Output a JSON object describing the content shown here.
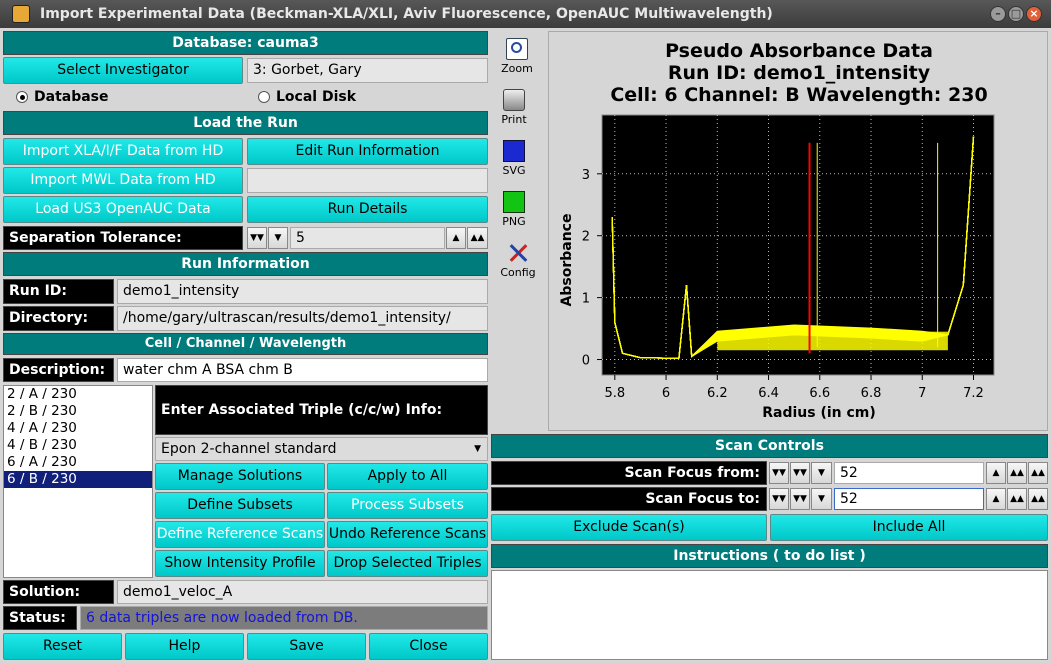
{
  "window": {
    "title": "Import Experimental Data (Beckman-XLA/XLI, Aviv Fluorescence, OpenAUC Multiwavelength)"
  },
  "left": {
    "database_header": "Database: cauma3",
    "select_investigator": "Select Investigator",
    "investigator_value": "3: Gorbet, Gary",
    "radio_database": "Database",
    "radio_local": "Local Disk",
    "load_run_header": "Load the Run",
    "import_xla": "Import XLA/I/F Data from HD",
    "edit_run_info": "Edit Run Information",
    "import_mwl": "Import MWL Data from HD",
    "load_us3": "Load US3 OpenAUC Data",
    "run_details": "Run Details",
    "sep_tol_label": "Separation Tolerance:",
    "sep_tol_value": "5",
    "run_info_header": "Run Information",
    "run_id_label": "Run ID:",
    "run_id_value": "demo1_intensity",
    "directory_label": "Directory:",
    "directory_value": "/home/gary/ultrascan/results/demo1_intensity/",
    "ccw_header": "Cell / Channel / Wavelength",
    "description_label": "Description:",
    "description_value": "water chm A BSA chm B",
    "triples": [
      "2 / A / 230",
      "2 / B / 230",
      "4 / A / 230",
      "4 / B / 230",
      "6 / A / 230",
      "6 / B / 230"
    ],
    "assoc_triple": "Enter Associated Triple (c/c/w) Info:",
    "centerpiece": "Epon 2-channel standard",
    "manage_solutions": "Manage Solutions",
    "apply_all": "Apply to All",
    "define_subsets": "Define Subsets",
    "process_subsets": "Process Subsets",
    "define_ref": "Define Reference Scans",
    "undo_ref": "Undo Reference Scans",
    "show_intensity": "Show Intensity Profile",
    "drop_triples": "Drop Selected Triples",
    "solution_label": "Solution:",
    "solution_value": "demo1_veloc_A",
    "status_label": "Status:",
    "status_value": "6 data triples are now loaded from DB.",
    "reset": "Reset",
    "help": "Help",
    "save": "Save",
    "close": "Close"
  },
  "toolbar": {
    "zoom": "Zoom",
    "print": "Print",
    "svg": "SVG",
    "png": "PNG",
    "config": "Config"
  },
  "scan": {
    "header": "Scan Controls",
    "from_label": "Scan Focus from:",
    "from_value": "52",
    "to_label": "Scan Focus to:",
    "to_value": "52",
    "exclude": "Exclude Scan(s)",
    "include_all": "Include All",
    "instructions": "Instructions ( to do list )"
  },
  "colors": {
    "teal_header": "#007c7c",
    "cyan_button": "#00d0d0",
    "plot_trace": "#ffff00",
    "highlight_scan": "#ff0000"
  },
  "chart_data": {
    "type": "line",
    "title_lines": [
      "Pseudo Absorbance Data",
      "Run ID: demo1_intensity",
      "Cell: 6  Channel: B  Wavelength: 230"
    ],
    "xlabel": "Radius (in cm)",
    "ylabel": "Absorbance",
    "xlim": [
      5.75,
      7.28
    ],
    "ylim": [
      -0.25,
      3.95
    ],
    "xticks": [
      5.8,
      6,
      6.2,
      6.4,
      6.6,
      6.8,
      7,
      7.2
    ],
    "yticks": [
      0,
      1,
      2,
      3
    ],
    "grid": true,
    "meniscus_x": 6.08,
    "vertical_spikes": [
      6.56,
      6.59,
      7.06
    ],
    "highlighted_scan_x": 6.56,
    "series": [
      {
        "values": [
          [
            5.79,
            2.3
          ],
          [
            5.8,
            0.6
          ],
          [
            5.83,
            0.1
          ],
          [
            5.9,
            0.03
          ],
          [
            6.05,
            0.02
          ],
          [
            6.08,
            1.2
          ],
          [
            6.1,
            0.05
          ],
          [
            6.2,
            0.3
          ],
          [
            6.5,
            0.4
          ],
          [
            6.8,
            0.35
          ],
          [
            7.0,
            0.3
          ],
          [
            7.1,
            0.4
          ],
          [
            7.16,
            1.2
          ],
          [
            7.2,
            3.6
          ]
        ]
      }
    ]
  }
}
